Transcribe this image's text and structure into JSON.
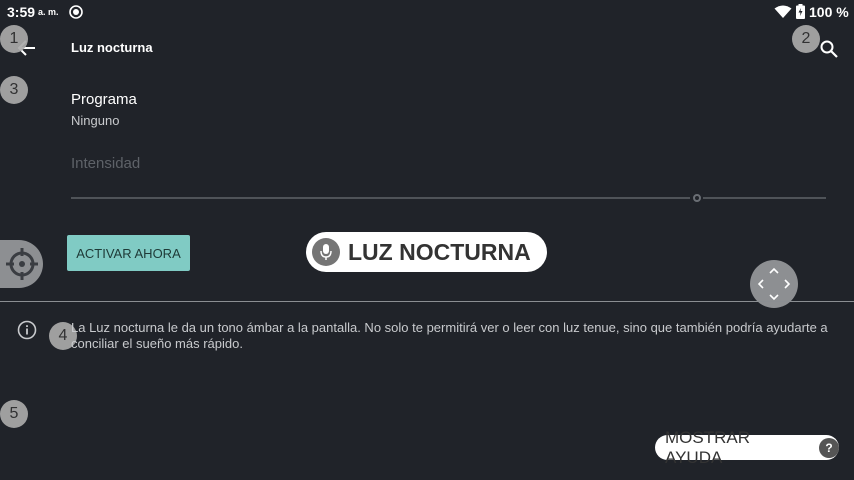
{
  "status_bar": {
    "time": "3:59",
    "ampm": "a. m.",
    "notification_icon": "location-icon",
    "wifi_icon": "wifi-icon",
    "battery_icon": "battery-icon",
    "battery_percent": "100 %"
  },
  "toolbar": {
    "title": "Luz nocturna",
    "back_icon": "arrow-back-icon",
    "search_icon": "search-icon"
  },
  "badges": [
    "1",
    "2",
    "3",
    "4",
    "5"
  ],
  "schedule": {
    "title": "Programa",
    "value": "Ninguno"
  },
  "intensity": {
    "label": "Intensidad",
    "level": 0.82
  },
  "activate_button": "ACTIVAR AHORA",
  "voice_label": "LUZ NOCTURNA",
  "info": {
    "icon": "info-icon",
    "text": "La Luz nocturna le da un tono ámbar a la pantalla. No solo te permitirá ver o leer con luz tenue, sino que también podría ayudarte a conciliar el sueño más rápido."
  },
  "help_button": {
    "label": "MOSTRAR AYUDA",
    "icon": "?"
  },
  "colors": {
    "background": "#202329",
    "accent": "#80cbc4"
  }
}
